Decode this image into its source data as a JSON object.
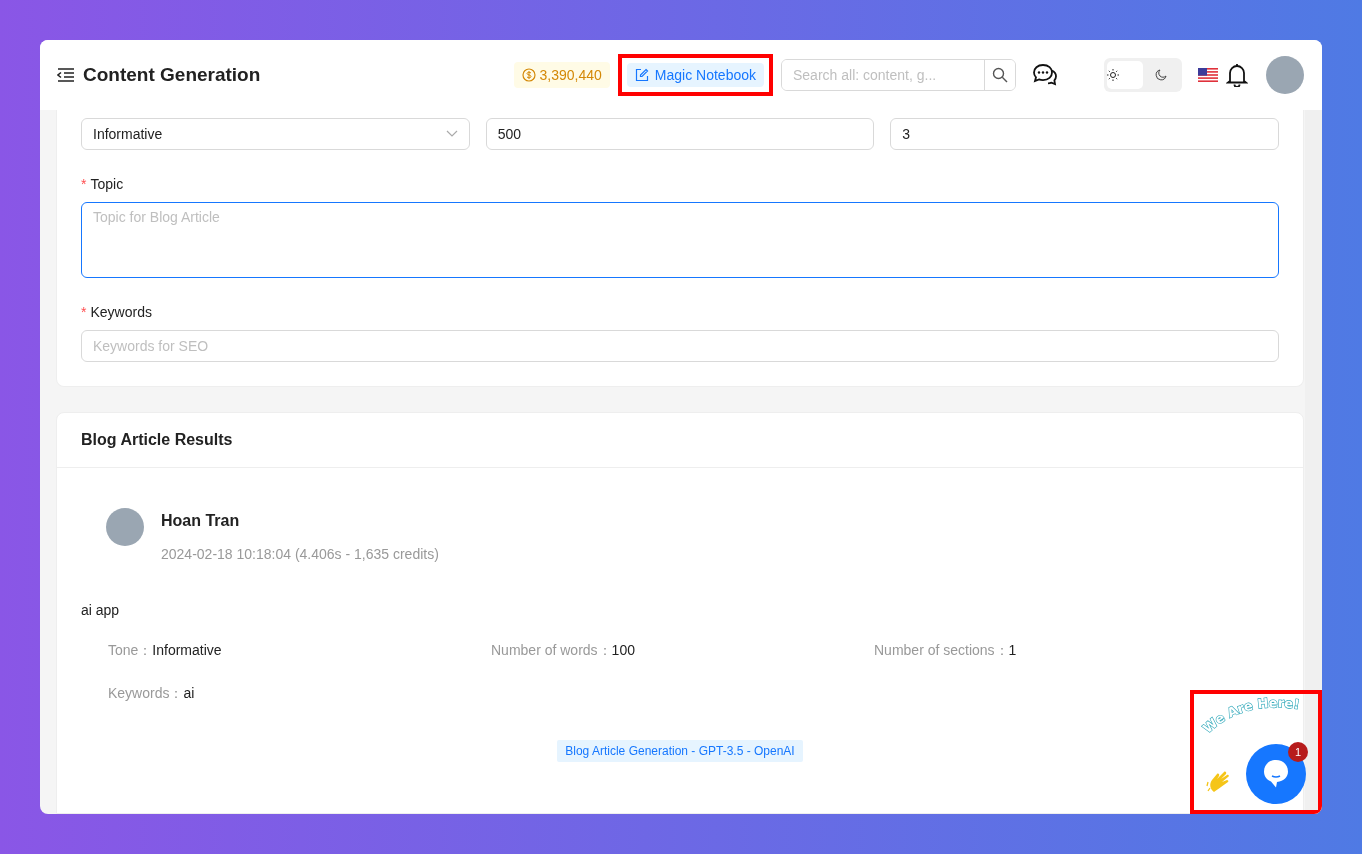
{
  "header": {
    "title": "Content Generation",
    "credits": "3,390,440",
    "notebook_button": {
      "label": "Magic Notebook",
      "highlighted": true
    },
    "search": {
      "placeholder": "Search all: content, g..."
    },
    "theme": [
      {
        "kind": "light",
        "selected": true
      },
      {
        "kind": "dark",
        "selected": false
      }
    ]
  },
  "form": {
    "row": [
      {
        "kind": "select",
        "value": "Informative"
      },
      {
        "kind": "input",
        "value": "500"
      },
      {
        "kind": "input",
        "value": "3"
      }
    ],
    "fields": [
      {
        "kind": "textarea",
        "label": "Topic",
        "required_mark": "*",
        "placeholder": "Topic for Blog Article",
        "focused": true
      },
      {
        "kind": "input",
        "label": "Keywords",
        "required_mark": "*",
        "placeholder": "Keywords for SEO",
        "focused": false
      }
    ]
  },
  "results": {
    "title": "Blog Article Results",
    "author": "Hoan Tran",
    "meta": "2024-02-18 10:18:04 (4.406s - 1,635 credits)",
    "prompt": "ai app",
    "details": [
      {
        "label": "Tone：",
        "value": "Informative"
      },
      {
        "label": "Number of words：",
        "value": "100"
      },
      {
        "label": "Number of sections：",
        "value": "1"
      },
      {
        "label": "Keywords：",
        "value": "ai"
      }
    ],
    "tag": "Blog Article Generation - GPT-3.5 - OpenAI"
  },
  "chat_widget": {
    "caption": "We Are Here!",
    "badge": "1",
    "highlighted": true
  }
}
